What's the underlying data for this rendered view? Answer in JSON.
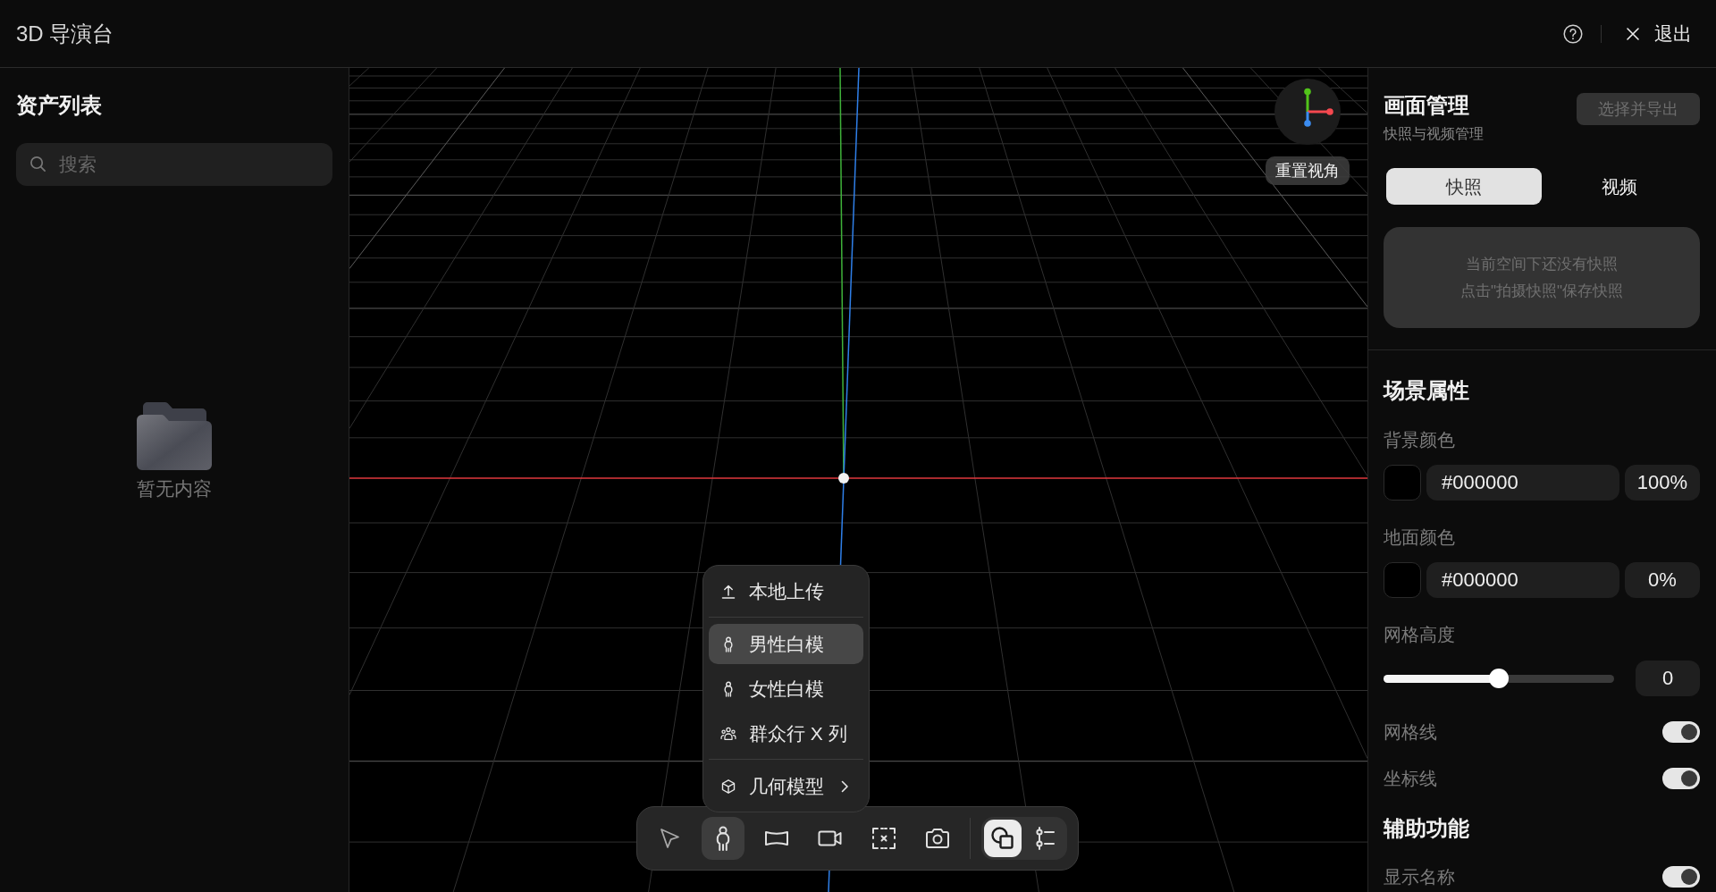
{
  "header": {
    "title": "3D 导演台",
    "exit_label": "退出"
  },
  "assets": {
    "title": "资产列表",
    "search": {
      "placeholder": "搜索"
    },
    "empty_text": "暂无内容"
  },
  "viewport": {
    "reset_label": "重置视角",
    "menu": {
      "sections": [
        {
          "items": [
            {
              "kind": "action",
              "label": "本地上传",
              "selected": false
            }
          ]
        },
        {
          "items": [
            {
              "kind": "action",
              "label": "男性白模",
              "selected": true
            },
            {
              "kind": "action",
              "label": "女性白模",
              "selected": false
            },
            {
              "kind": "action",
              "label": "群众行 X 列",
              "selected": false
            }
          ]
        },
        {
          "items": [
            {
              "kind": "submenu",
              "label": "几何模型",
              "selected": false
            }
          ]
        }
      ]
    },
    "toolbar": {
      "tools": [
        {
          "selected": false
        },
        {
          "selected": true
        },
        {
          "selected": false
        },
        {
          "selected": false
        },
        {
          "selected": false
        },
        {
          "selected": false
        }
      ],
      "modes": [
        {
          "selected": true
        },
        {
          "selected": false
        }
      ]
    }
  },
  "frames": {
    "title": "画面管理",
    "subtitle": "快照与视频管理",
    "export_button": {
      "label": "选择并导出",
      "disabled": true
    },
    "tabs": [
      {
        "label": "快照",
        "selected": true
      },
      {
        "label": "视频",
        "selected": false
      }
    ],
    "empty_lines": [
      "当前空间下还没有快照",
      "点击\"拍摄快照\"保存快照"
    ]
  },
  "sections": [
    {
      "title": "场景属性",
      "rows": [
        {
          "kind": "color",
          "label": "背景颜色",
          "color": "#000000",
          "value": "#000000",
          "opacity": "100%"
        },
        {
          "kind": "color",
          "label": "地面颜色",
          "color": "#000000",
          "value": "#000000",
          "opacity": "0%"
        },
        {
          "kind": "slider",
          "label": "网格高度",
          "level": 0.5,
          "value": "0"
        },
        {
          "kind": "toggle",
          "label": "网格线",
          "on": true
        },
        {
          "kind": "toggle",
          "label": "坐标线",
          "on": true
        }
      ]
    },
    {
      "title": "辅助功能",
      "rows": [
        {
          "kind": "toggle",
          "label": "显示名称",
          "on": true
        }
      ]
    }
  ]
}
